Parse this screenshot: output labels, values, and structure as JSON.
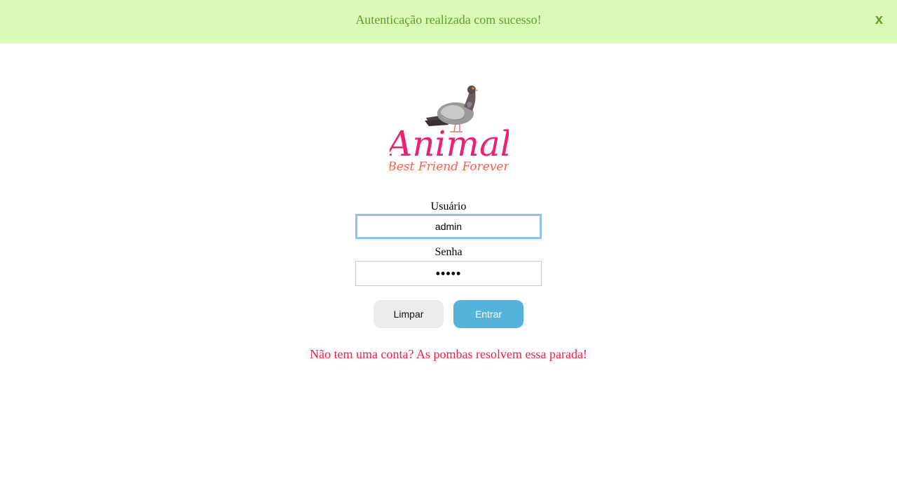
{
  "alert": {
    "message": "Autenticação realizada com sucesso!",
    "close_label": "x"
  },
  "logo": {
    "title": "Animal",
    "tagline": "Best Friend Forever",
    "icon": "pigeon-icon",
    "colors": {
      "title": "#ef1f74",
      "tagline": "#f0614f"
    }
  },
  "form": {
    "username": {
      "label": "Usuário",
      "value": "admin"
    },
    "password": {
      "label": "Senha",
      "value": "•••••"
    },
    "buttons": {
      "clear": "Limpar",
      "submit": "Entrar"
    }
  },
  "signup": {
    "text": "Não tem uma conta? As pombas resolvem essa parada!"
  },
  "colors": {
    "alert_bg": "#dafbb8",
    "alert_text": "#5ea21e",
    "submit_bg": "#53b3db",
    "clear_bg": "#ececec",
    "link": "#ef1f4b",
    "focus_border": "#90c1f5"
  }
}
